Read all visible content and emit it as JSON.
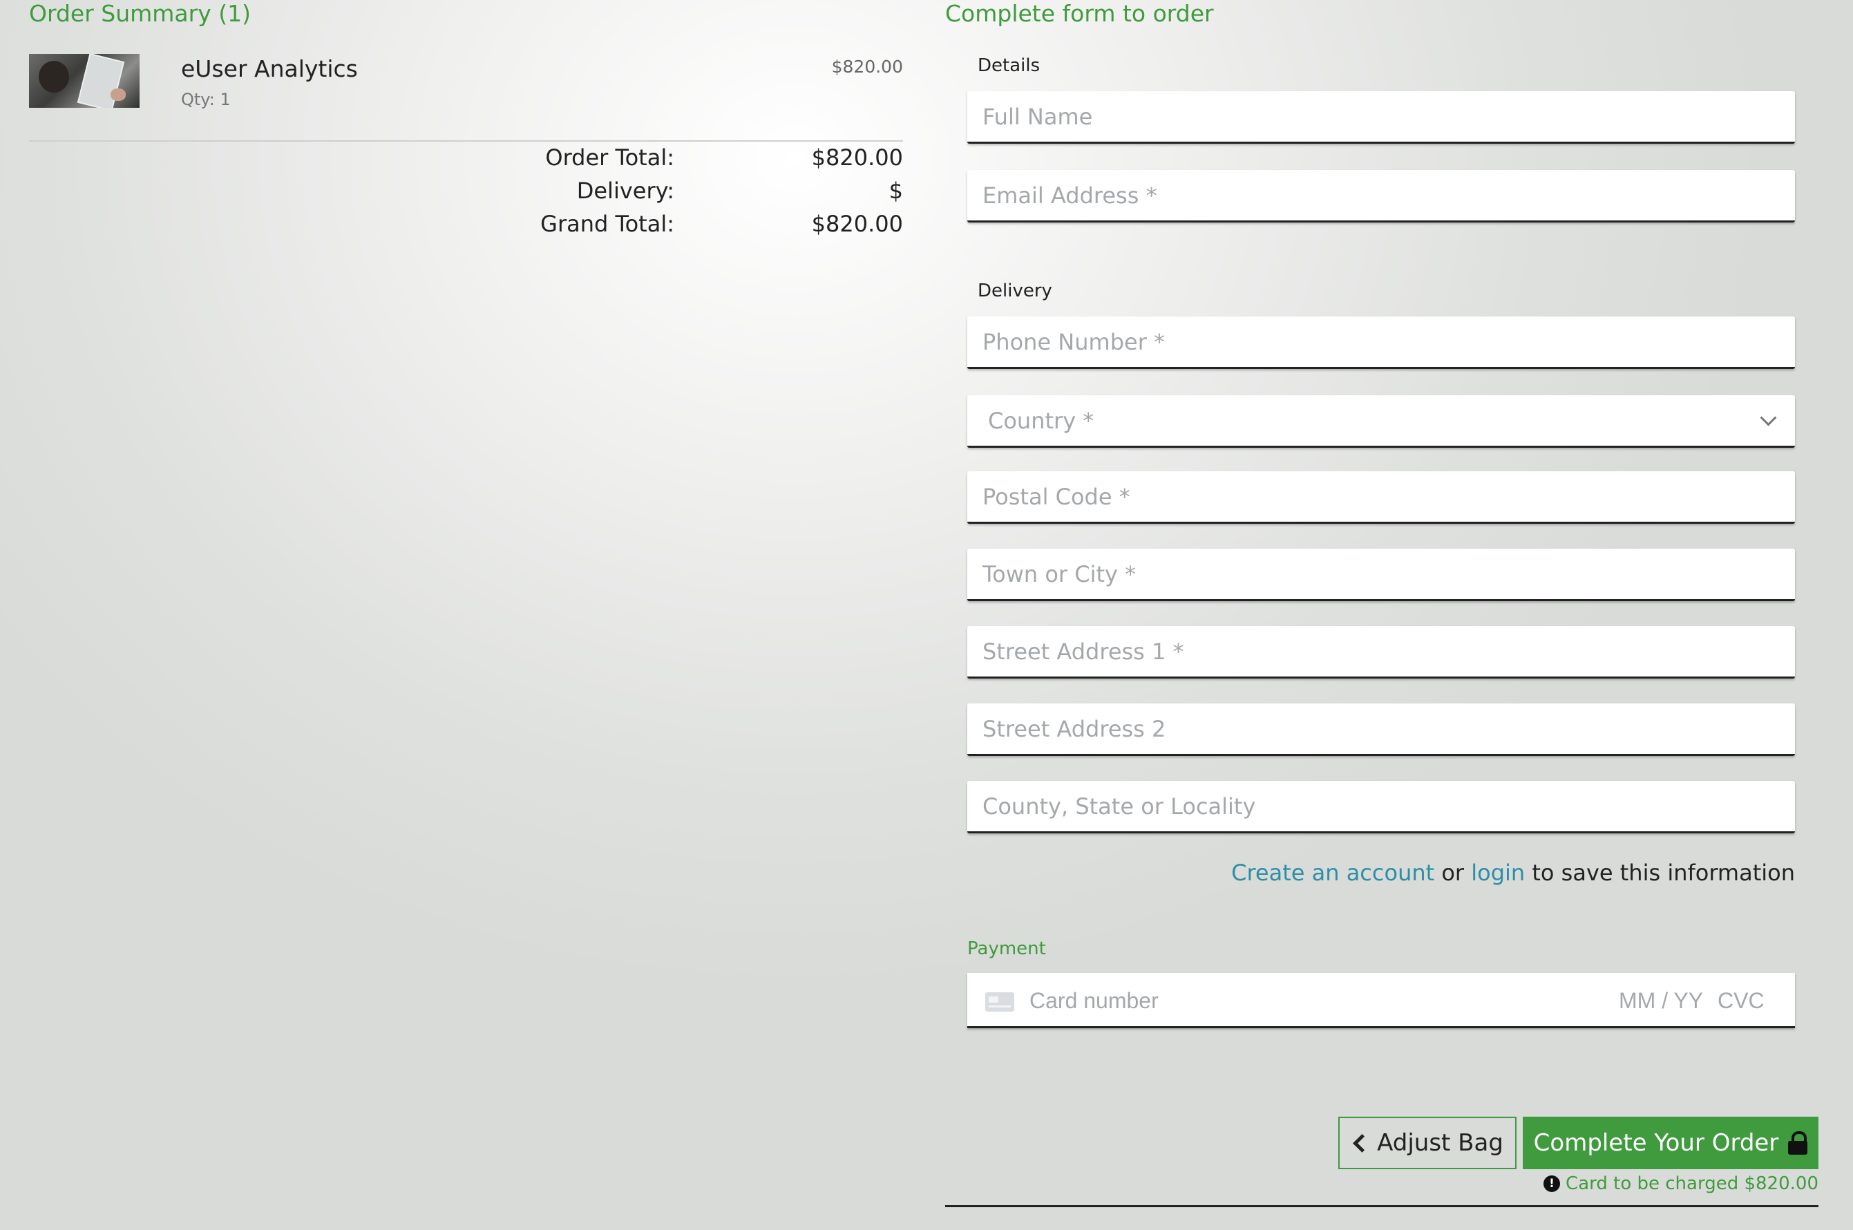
{
  "order_summary": {
    "title": "Order Summary (1)",
    "item": {
      "name": "eUser Analytics",
      "qty": "Qty: 1",
      "price": "$820.00"
    },
    "totals": {
      "order_total_label": "Order Total:",
      "order_total_value": "$820.00",
      "delivery_label": "Delivery:",
      "delivery_value": "$",
      "grand_total_label": "Grand Total:",
      "grand_total_value": "$820.00"
    }
  },
  "form": {
    "title": "Complete form to order",
    "details_label": "Details",
    "full_name_placeholder": "Full Name",
    "email_placeholder": "Email Address *",
    "delivery_label": "Delivery",
    "phone_placeholder": "Phone Number *",
    "country_placeholder": "Country *",
    "postal_placeholder": "Postal Code *",
    "town_placeholder": "Town or City *",
    "street1_placeholder": "Street Address 1 *",
    "street2_placeholder": "Street Address 2",
    "county_placeholder": "County, State or Locality",
    "save_info": {
      "create_account": "Create an account",
      "or": " or ",
      "login": "login",
      "suffix": " to save this information"
    },
    "payment_label": "Payment",
    "card": {
      "number_placeholder": "Card number",
      "expiry_placeholder": "MM / YY",
      "cvc_placeholder": "CVC"
    }
  },
  "actions": {
    "adjust_bag": "Adjust Bag",
    "complete_order": "Complete Your Order",
    "charge_note": "Card to be charged $820.00"
  },
  "colors": {
    "accent_green": "#3f9b3d",
    "link_teal": "#2d8fa5"
  },
  "icons": {
    "product_thumbnail": "product-photo",
    "country_select": "chevron-down-icon",
    "card": "credit-card-icon",
    "adjust_bag": "chevron-left-icon",
    "complete_order": "lock-icon",
    "charge_note": "info-circle-icon"
  }
}
